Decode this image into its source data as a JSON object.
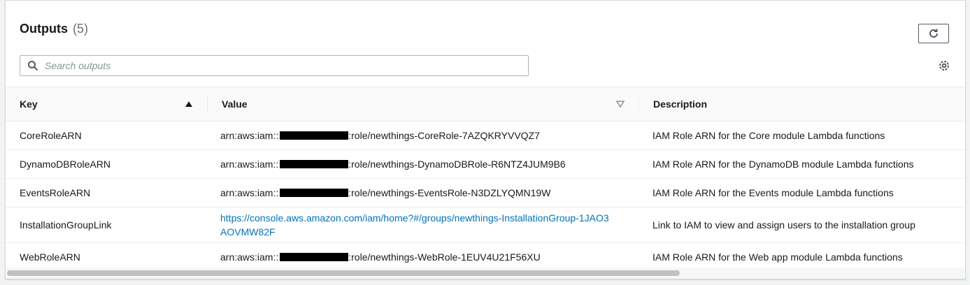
{
  "panel": {
    "title": "Outputs",
    "count": "(5)"
  },
  "search": {
    "placeholder": "Search outputs"
  },
  "icons": {
    "refresh": "refresh-icon",
    "search": "search-icon",
    "settings": "gear-icon",
    "sort_asc": "caret-up-icon",
    "sort_none": "caret-down-outline-icon"
  },
  "table": {
    "columns": {
      "key": "Key",
      "value": "Value",
      "description": "Description"
    },
    "rows": [
      {
        "key": "CoreRoleARN",
        "value_prefix": "arn:aws:iam::",
        "value_suffix": ":role/newthings-CoreRole-7AZQKRYVVQZ7",
        "description": "IAM Role ARN for the Core module Lambda functions"
      },
      {
        "key": "DynamoDBRoleARN",
        "value_prefix": "arn:aws:iam::",
        "value_suffix": ":role/newthings-DynamoDBRole-R6NTZ4JUM9B6",
        "description": "IAM Role ARN for the DynamoDB module Lambda functions"
      },
      {
        "key": "EventsRoleARN",
        "value_prefix": "arn:aws:iam::",
        "value_suffix": ":role/newthings-EventsRole-N3DZLYQMN19W",
        "description": "IAM Role ARN for the Events module Lambda functions"
      },
      {
        "key": "InstallationGroupLink",
        "value_link": "https://console.aws.amazon.com/iam/home?#/groups/newthings-InstallationGroup-1JAO3AOVMW82F",
        "description": "Link to IAM to view and assign users to the installation group"
      },
      {
        "key": "WebRoleARN",
        "value_prefix": "arn:aws:iam::",
        "value_suffix": ":role/newthings-WebRole-1EUV4U21F56XU",
        "description": "IAM Role ARN for the Web app module Lambda functions"
      }
    ]
  },
  "colors": {
    "link": "#0073bb",
    "border": "#eaeded",
    "background": "#f2f3f3"
  }
}
